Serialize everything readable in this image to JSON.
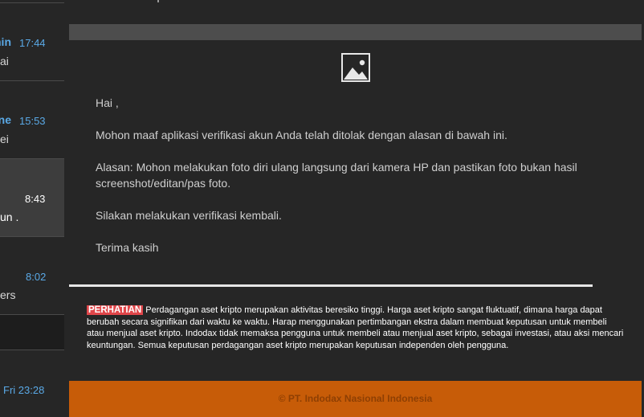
{
  "message_list": [
    {
      "sender": "Indodax Admin",
      "time": "17:44",
      "preview": "ai"
    },
    {
      "sender": "Indodax Online",
      "time": "15:53",
      "preview": "ei"
    },
    {
      "sender": "",
      "time": "8:43",
      "preview": "un ."
    },
    {
      "sender": "",
      "time": "8:02",
      "preview": "ers"
    },
    {
      "sender": "",
      "time": "",
      "preview": ""
    },
    {
      "sender": "",
      "time": "Fri 23:28",
      "preview": ""
    }
  ],
  "email": {
    "image_icon": "image-placeholder-icon",
    "greeting": "Hai ,",
    "paragraph1": "Mohon maaf aplikasi verifikasi akun Anda telah ditolak dengan alasan di bawah ini.",
    "paragraph2": "Alasan: Mohon melakukan foto diri ulang langsung dari kamera HP dan pastikan foto bukan hasil screenshot/editan/pas foto.",
    "paragraph3": "Silakan melakukan verifikasi kembali.",
    "closing": "Terima kasih",
    "disclaimer_badge": "PERHATIAN",
    "disclaimer_text": "Perdagangan aset kripto merupakan aktivitas beresiko tinggi. Harga aset kripto sangat fluktuatif, dimana harga dapat berubah secara signifikan dari waktu ke waktu. Harap menggunakan pertimbangan ekstra dalam membuat keputusan untuk membeli atau menjual aset kripto. Indodax tidak memaksa pengguna untuk membeli atau menjual aset kripto, sebagai investasi, atau aksi mencari keuntungan. Semua keputusan perdagangan aset kripto merupakan keputusan independen oleh pengguna.",
    "footer": "© PT. Indodax Nasional Indonesia"
  },
  "colors": {
    "background": "#262626",
    "accent_blue": "#5aa9e6",
    "badge_red": "#e0464a",
    "footer_orange": "#c75c08"
  }
}
